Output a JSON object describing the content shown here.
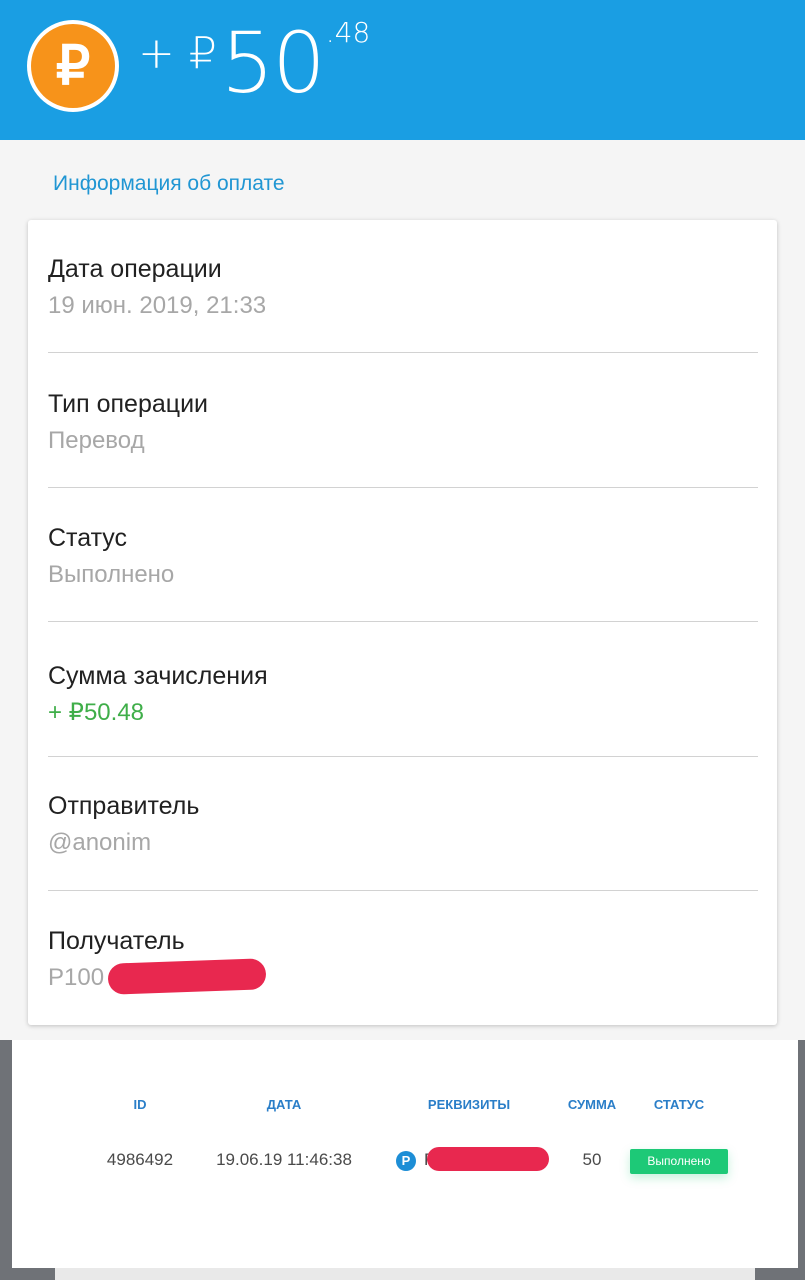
{
  "header": {
    "currency_icon": "ruble-coin-icon",
    "currency_glyph": "₽",
    "amount_sign": "+ ₽",
    "amount_integer": "50",
    "amount_fraction": ".48"
  },
  "section_title": "Информация об оплате",
  "details": [
    {
      "label": "Дата операции",
      "value": "19 июн. 2019, 21:33"
    },
    {
      "label": "Тип операции",
      "value": "Перевод"
    },
    {
      "label": "Статус",
      "value": "Выполнено"
    },
    {
      "label": "Сумма зачисления",
      "value": "+ ₽50.48"
    },
    {
      "label": "Отправитель",
      "value": "@anonim"
    },
    {
      "label": "Получатель",
      "value": "P100"
    }
  ],
  "table": {
    "headers": [
      "ID",
      "ДАТА",
      "РЕКВИЗИТЫ",
      "СУММА",
      "СТАТУС"
    ],
    "row": {
      "id": "4986492",
      "date": "19.06.19 11:46:38",
      "requisites_icon": "payeer-p-icon",
      "requisites_glyph": "P",
      "requisites": "P",
      "amount": "50",
      "status": "Выполнено"
    }
  },
  "colors": {
    "header_bg": "#1a9ee3",
    "coin": "#f7931a",
    "accent_text": "#2096d3",
    "positive_amount": "#3fae49",
    "redaction": "#e8284f",
    "status_badge": "#1dc977"
  }
}
